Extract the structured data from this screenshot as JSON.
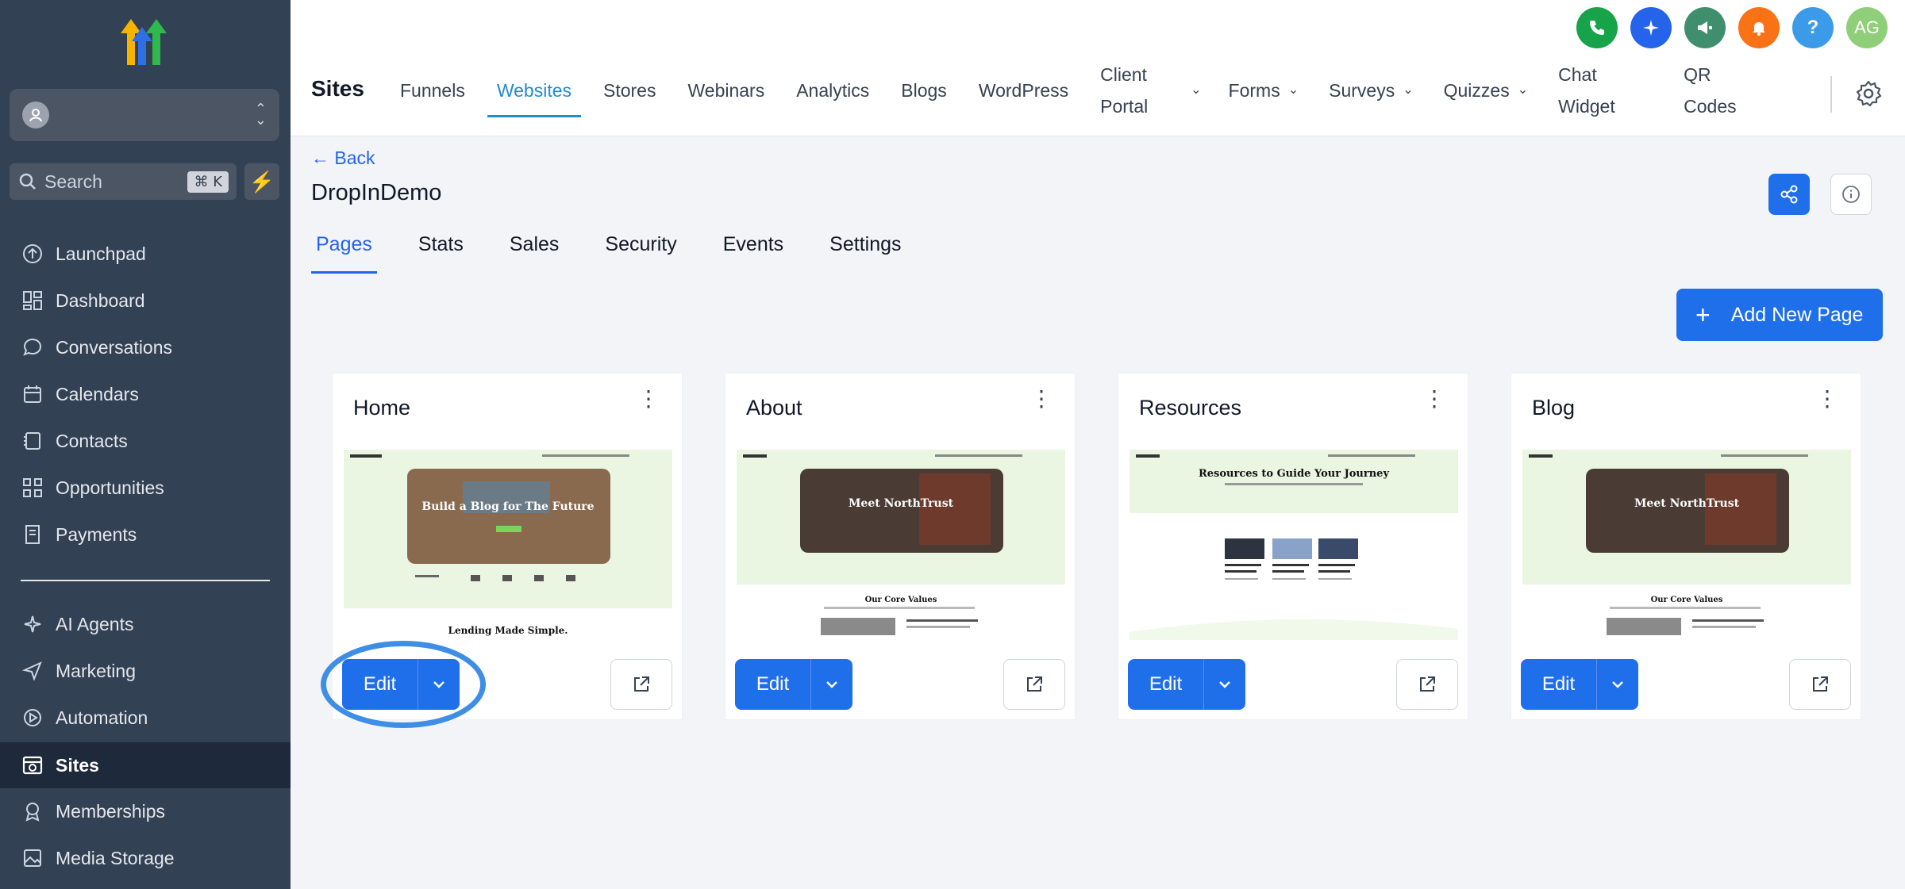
{
  "sidebar": {
    "search": {
      "placeholder": "Search",
      "shortcut": "⌘ K"
    },
    "items": [
      {
        "label": "Launchpad",
        "icon": "launchpad-icon"
      },
      {
        "label": "Dashboard",
        "icon": "dashboard-icon"
      },
      {
        "label": "Conversations",
        "icon": "chat-bubble-icon"
      },
      {
        "label": "Calendars",
        "icon": "calendar-icon"
      },
      {
        "label": "Contacts",
        "icon": "contacts-icon"
      },
      {
        "label": "Opportunities",
        "icon": "opportunities-icon"
      },
      {
        "label": "Payments",
        "icon": "payments-icon"
      },
      {
        "label": "AI Agents",
        "icon": "sparkle-icon"
      },
      {
        "label": "Marketing",
        "icon": "send-icon"
      },
      {
        "label": "Automation",
        "icon": "automation-icon"
      },
      {
        "label": "Sites",
        "icon": "sites-icon",
        "active": true
      },
      {
        "label": "Memberships",
        "icon": "memberships-icon"
      },
      {
        "label": "Media Storage",
        "icon": "image-icon"
      }
    ]
  },
  "header": {
    "title": "Sites",
    "tabs": [
      {
        "label": "Funnels"
      },
      {
        "label": "Websites",
        "active": true
      },
      {
        "label": "Stores"
      },
      {
        "label": "Webinars"
      },
      {
        "label": "Analytics"
      },
      {
        "label": "Blogs"
      },
      {
        "label": "WordPress"
      },
      {
        "label": "Client Portal",
        "line1": "Client",
        "line2": "Portal"
      },
      {
        "label": "Forms"
      },
      {
        "label": "Surveys"
      },
      {
        "label": "Quizzes"
      },
      {
        "label": "Chat Widget",
        "line1": "Chat",
        "line2": "Widget"
      },
      {
        "label": "QR Codes",
        "line1": "QR",
        "line2": "Codes"
      }
    ],
    "icons": [
      {
        "name": "phone-icon",
        "color": "#16a34a"
      },
      {
        "name": "magic-icon",
        "color": "#2563eb"
      },
      {
        "name": "megaphone-icon",
        "color": "#3f8f6e"
      },
      {
        "name": "bell-icon",
        "color": "#f97316"
      },
      {
        "name": "help-icon",
        "color": "#3b9be8"
      },
      {
        "name": "user-avatar",
        "color": "#8fcf7a",
        "initials": "AG"
      }
    ]
  },
  "page": {
    "back_label": "← Back",
    "site_name": "DropInDemo",
    "subtabs": [
      "Pages",
      "Stats",
      "Sales",
      "Security",
      "Events",
      "Settings"
    ],
    "add_page_label": "Add New Page",
    "edit_label": "Edit"
  },
  "cards": [
    {
      "title": "Home",
      "thumb_heading": "Build a Blog for The Future",
      "thumb_footer": "Lending Made Simple."
    },
    {
      "title": "About",
      "thumb_heading": "Meet NorthTrust",
      "thumb_footer": "Our Core Values"
    },
    {
      "title": "Resources",
      "thumb_heading": "Resources to Guide Your Journey",
      "thumb_footer": ""
    },
    {
      "title": "Blog",
      "thumb_heading": "Meet NorthTrust",
      "thumb_footer": "Our Core Values"
    }
  ],
  "colors": {
    "primary": "#1f6feb",
    "active_tab": "#1d8bd6",
    "sidebar": "#334155",
    "highlight": "#3f8ee6"
  }
}
